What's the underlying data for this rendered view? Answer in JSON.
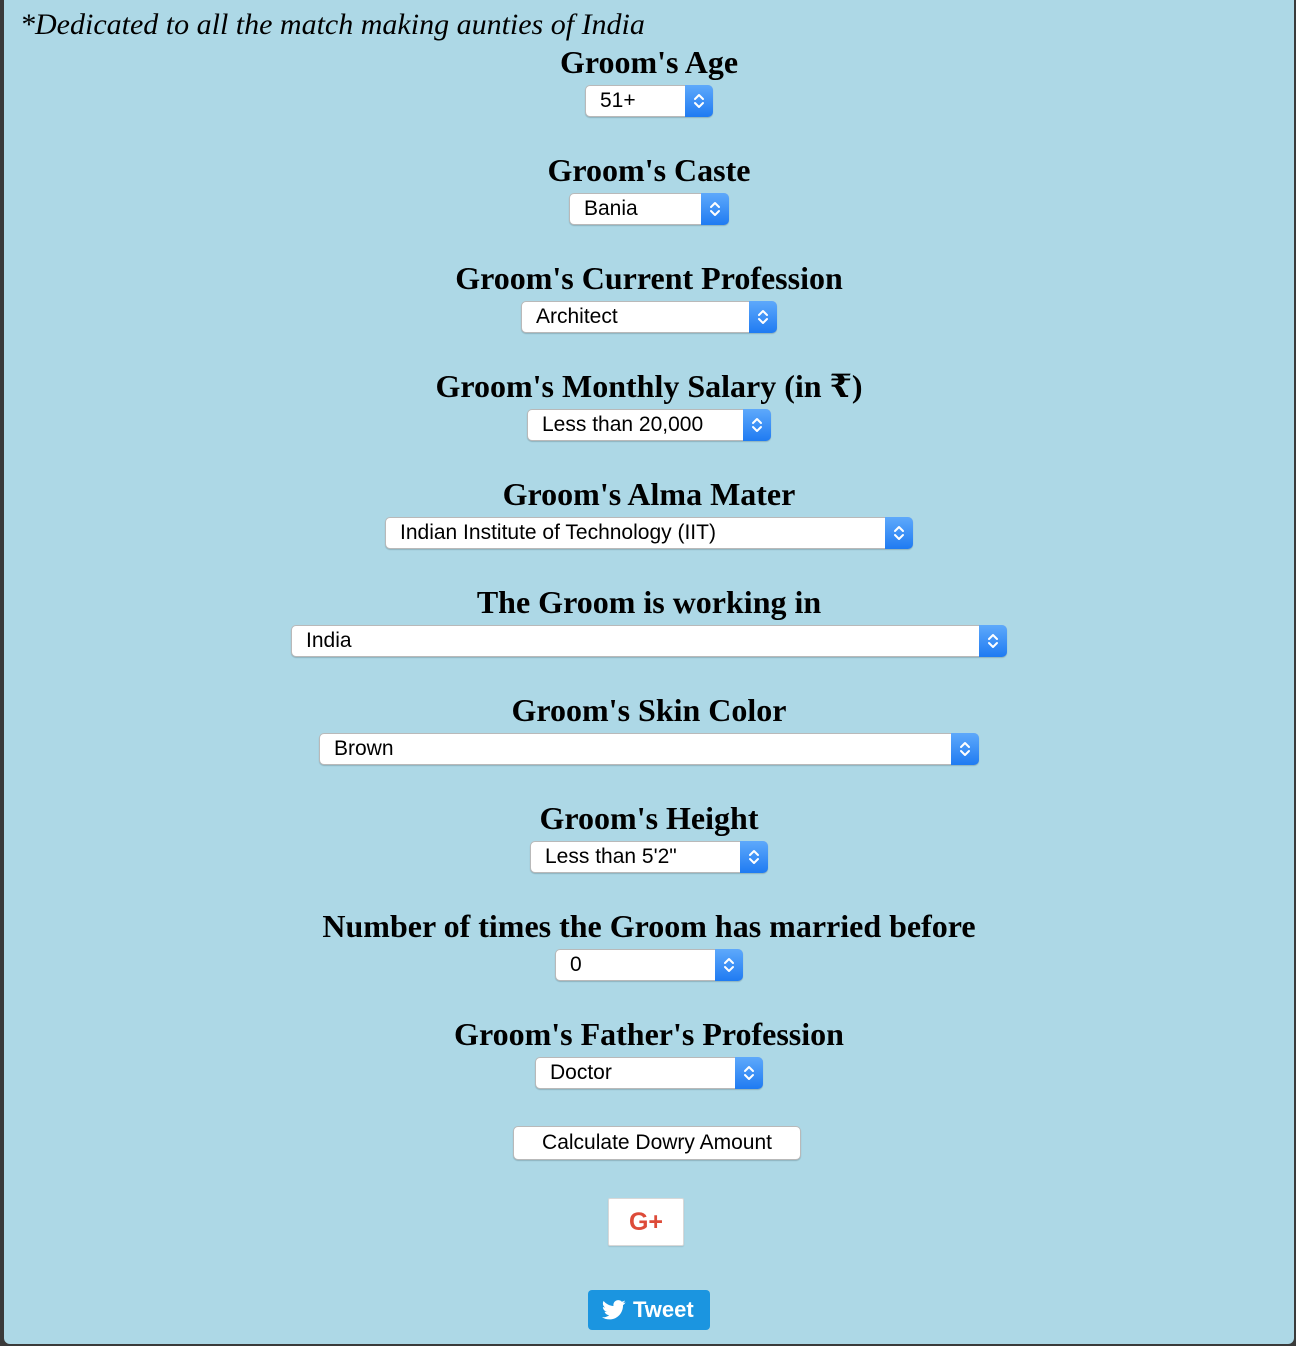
{
  "dedication": "*Dedicated to all the match making aunties of India",
  "fields": [
    {
      "label": "Groom's Age",
      "value": "51+"
    },
    {
      "label": "Groom's Caste",
      "value": "Bania"
    },
    {
      "label": "Groom's Current Profession",
      "value": "Architect"
    },
    {
      "label": "Groom's Monthly Salary (in ₹)",
      "value": "Less than 20,000"
    },
    {
      "label": "Groom's Alma Mater",
      "value": "Indian Institute of Technology (IIT)"
    },
    {
      "label": "The Groom is working in",
      "value": "India"
    },
    {
      "label": "Groom's Skin Color",
      "value": "Brown"
    },
    {
      "label": "Groom's Height",
      "value": "Less than 5'2\""
    },
    {
      "label": "Number of times the Groom has married before",
      "value": "0"
    },
    {
      "label": "Groom's Father's Profession",
      "value": "Doctor"
    }
  ],
  "calculate_button": "Calculate Dowry Amount",
  "gplus_icon": "G+",
  "tweet_button": "Tweet",
  "colors": {
    "background": "#add8e6",
    "select_arrow": "#2d86f5",
    "tweet": "#1b95e0",
    "gplus": "#dd4b39"
  }
}
